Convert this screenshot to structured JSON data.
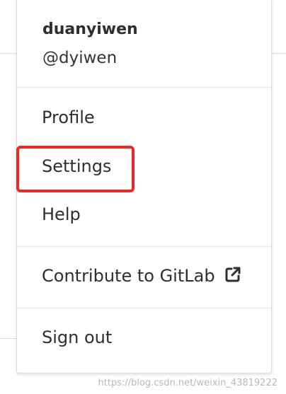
{
  "user": {
    "name": "duanyiwen",
    "handle": "@dyiwen"
  },
  "menu": {
    "profile": "Profile",
    "settings": "Settings",
    "help": "Help",
    "contribute": "Contribute to GitLab",
    "sign_out": "Sign out"
  },
  "icons": {
    "external_link": "external-link-icon"
  },
  "colors": {
    "highlight": "#f02525",
    "text": "#2e2e2e",
    "divider": "#e5e5e5"
  },
  "watermark": "https://blog.csdn.net/weixin_43819222"
}
